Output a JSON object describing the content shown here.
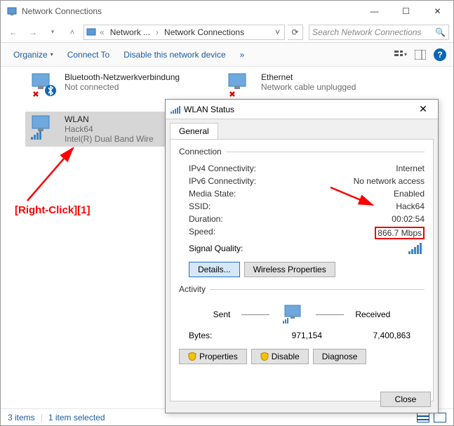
{
  "window": {
    "title": "Network Connections",
    "min": "—",
    "max": "☐",
    "close": "✕"
  },
  "addressbar": {
    "back": "←",
    "forward": "→",
    "up": "˄",
    "seg1": "Network ...",
    "seg2": "Network Connections",
    "refresh": "⟳",
    "search_placeholder": "Search Network Connections",
    "search_icon": "🔍"
  },
  "toolbar": {
    "organize": "Organize",
    "connect_to": "Connect To",
    "disable": "Disable this network device",
    "more": "»"
  },
  "connections": {
    "bt": {
      "name": "Bluetooth-Netzwerkverbindung",
      "sub1": "Not connected",
      "sub2": ""
    },
    "eth": {
      "name": "Ethernet",
      "sub1": "Network cable unplugged",
      "sub2": ""
    },
    "wlan": {
      "name": "WLAN",
      "sub1": "Hack64",
      "sub2": "Intel(R) Dual Band Wire"
    }
  },
  "dialog": {
    "title": "WLAN Status",
    "close": "✕",
    "tab": "General",
    "connection_label": "Connection",
    "rows": {
      "ipv4_k": "IPv4 Connectivity:",
      "ipv4_v": "Internet",
      "ipv6_k": "IPv6 Connectivity:",
      "ipv6_v": "No network access",
      "media_k": "Media State:",
      "media_v": "Enabled",
      "ssid_k": "SSID:",
      "ssid_v": "Hack64",
      "duration_k": "Duration:",
      "duration_v": "00:02:54",
      "speed_k": "Speed:",
      "speed_v": "866.7 Mbps",
      "signal_k": "Signal Quality:"
    },
    "details_btn": "Details...",
    "wireless_btn": "Wireless Properties",
    "activity_label": "Activity",
    "sent": "Sent",
    "received": "Received",
    "bytes_label": "Bytes:",
    "bytes_sent": "971,154",
    "bytes_recv": "7,400,863",
    "properties": "Properties",
    "disable": "Disable",
    "diagnose": "Diagnose",
    "close_btn": "Close"
  },
  "statusbar": {
    "items": "3 items",
    "selected": "1 item selected"
  },
  "annotation": {
    "text": "[Right-Click][1]"
  }
}
